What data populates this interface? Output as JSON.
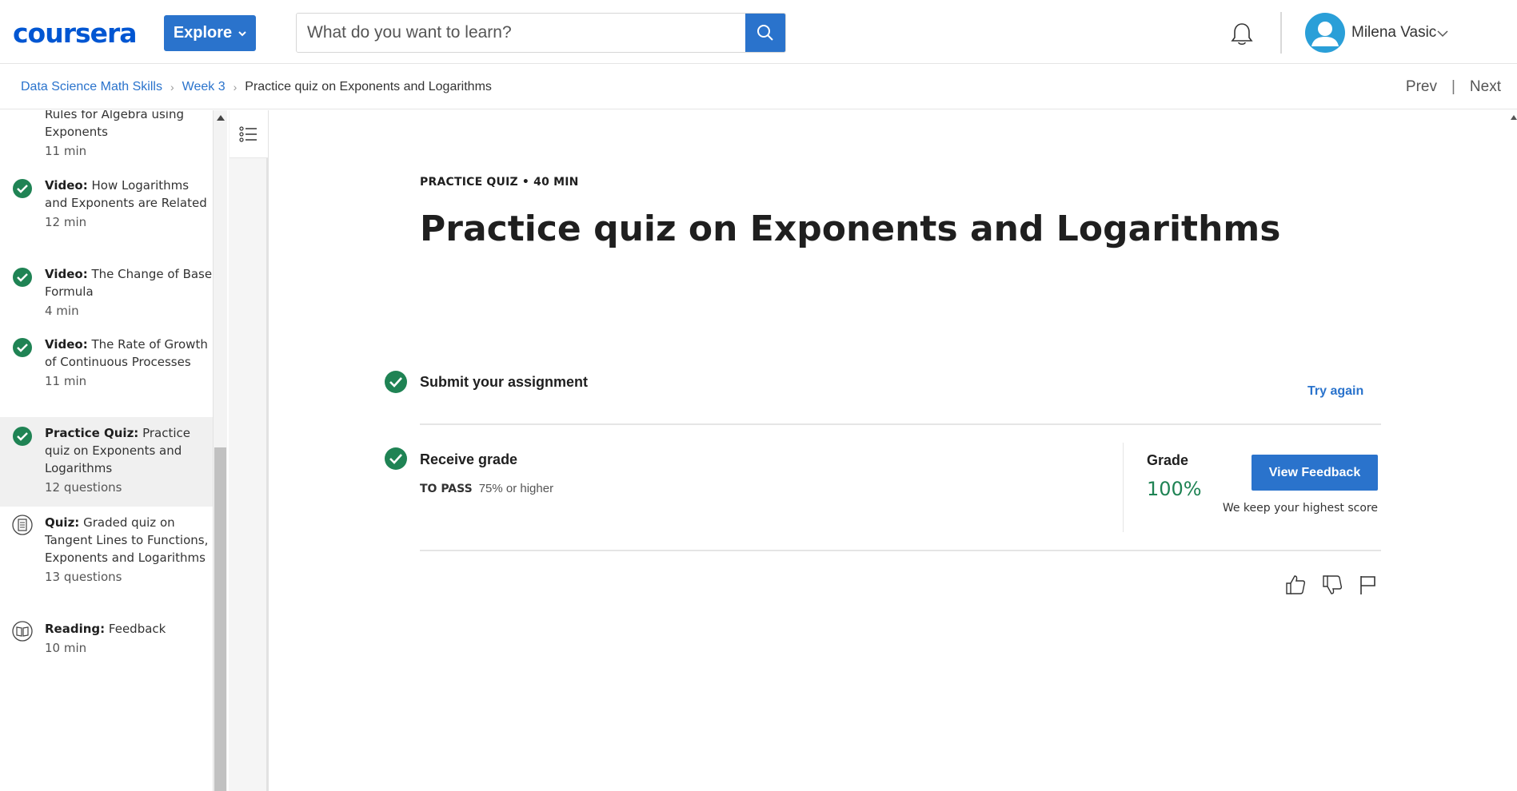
{
  "header": {
    "logo_text": "coursera",
    "explore_label": "Explore",
    "search_placeholder": "What do you want to learn?",
    "user_name": "Milena Vasic"
  },
  "breadcrumb": {
    "items": [
      "Data Science Math Skills",
      "Week 3"
    ],
    "current": "Practice quiz on Exponents and Logarithms"
  },
  "nav": {
    "prev": "Prev",
    "separator": "|",
    "next": "Next"
  },
  "sidebar": {
    "items": [
      {
        "kind": "",
        "title": "Rules for Algebra using Exponents",
        "meta": "11 min",
        "icon": "none",
        "status": "partial"
      },
      {
        "kind": "Video:",
        "title": "How Logarithms and Exponents are Related",
        "meta": "12 min",
        "icon": "check-circle-icon",
        "status": "completed"
      },
      {
        "kind": "Video:",
        "title": "The Change of Base Formula",
        "meta": "4 min",
        "icon": "check-circle-icon",
        "status": "completed"
      },
      {
        "kind": "Video:",
        "title": "The Rate of Growth of Continuous Processes",
        "meta": "11 min",
        "icon": "check-circle-icon",
        "status": "completed"
      },
      {
        "kind": "Practice Quiz:",
        "title": "Practice quiz on Exponents and Logarithms",
        "meta": "12 questions",
        "icon": "check-circle-icon",
        "status": "active"
      },
      {
        "kind": "Quiz:",
        "title": "Graded quiz on Tangent Lines to Functions, Exponents and Logarithms",
        "meta": "13 questions",
        "icon": "quiz-icon",
        "status": "pending"
      },
      {
        "kind": "Reading:",
        "title": "Feedback",
        "meta": "10 min",
        "icon": "book-icon",
        "status": "pending"
      }
    ]
  },
  "main": {
    "eyebrow": "PRACTICE QUIZ • 40 MIN",
    "title": "Practice quiz on Exponents and Logarithms",
    "submit_label": "Submit your assignment",
    "try_again": "Try again",
    "receive_label": "Receive grade",
    "to_pass_label": "TO PASS",
    "to_pass_value": "75% or higher",
    "grade_label": "Grade",
    "grade_value": "100%",
    "view_feedback": "View Feedback",
    "keep_score": "We keep your highest score"
  },
  "colors": {
    "brand_blue": "#2a73cc",
    "success_green": "#1f8354",
    "check_green": "#1f8354"
  }
}
